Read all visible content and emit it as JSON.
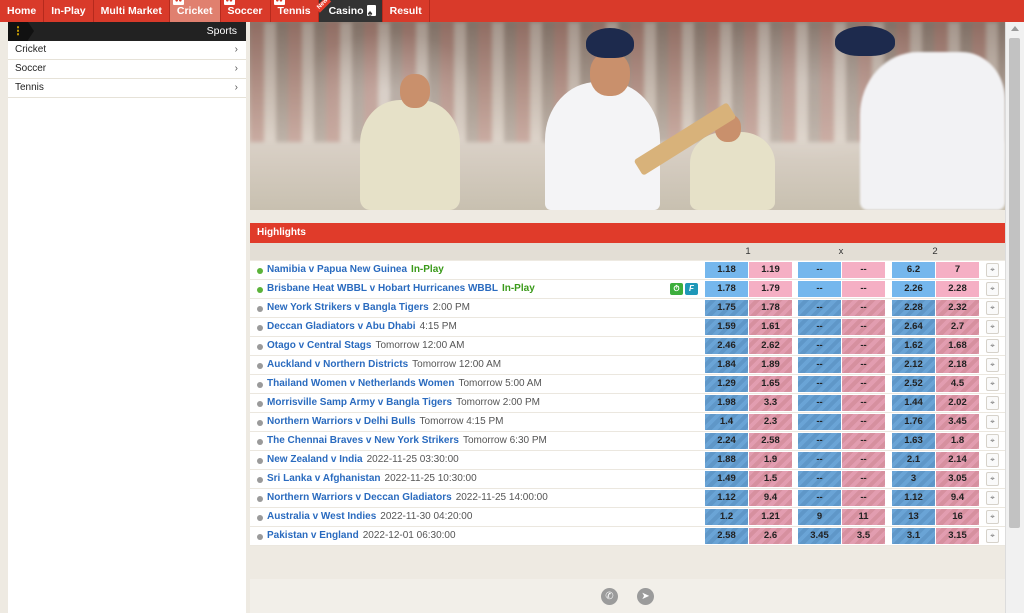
{
  "nav": {
    "items": [
      {
        "label": "Home",
        "active": false
      },
      {
        "label": "In-Play",
        "active": false
      },
      {
        "label": "Multi Market",
        "active": false
      },
      {
        "label": "Cricket",
        "active": true
      },
      {
        "label": "Soccer",
        "active": false
      },
      {
        "label": "Tennis",
        "active": false
      },
      {
        "label": "Casino",
        "active": false
      },
      {
        "label": "Result",
        "active": false
      }
    ],
    "new_ribbon": "New"
  },
  "sidebar": {
    "title": "Sports",
    "menu_icon": "⋮",
    "items": [
      {
        "label": "Cricket"
      },
      {
        "label": "Soccer"
      },
      {
        "label": "Tennis"
      }
    ]
  },
  "highlights": {
    "title": "Highlights",
    "col_1": "1",
    "col_x": "x",
    "col_2": "2"
  },
  "matches": [
    {
      "name": "Namibia v Papua New Guinea",
      "time": "",
      "live": true,
      "live_label": "In-Play",
      "icons": false,
      "suspended": false,
      "odds": [
        "1.18",
        "1.19",
        "--",
        "--",
        "6.2",
        "7"
      ]
    },
    {
      "name": "Brisbane Heat WBBL v Hobart Hurricanes WBBL",
      "time": "",
      "live": true,
      "live_label": "In-Play",
      "icons": true,
      "suspended": false,
      "odds": [
        "1.78",
        "1.79",
        "--",
        "--",
        "2.26",
        "2.28"
      ]
    },
    {
      "name": "New York Strikers v Bangla Tigers",
      "time": "2:00 PM",
      "live": false,
      "icons": false,
      "suspended": true,
      "odds": [
        "1.75",
        "1.78",
        "--",
        "--",
        "2.28",
        "2.32"
      ]
    },
    {
      "name": "Deccan Gladiators v Abu Dhabi",
      "time": "4:15 PM",
      "live": false,
      "icons": false,
      "suspended": true,
      "odds": [
        "1.59",
        "1.61",
        "--",
        "--",
        "2.64",
        "2.7"
      ]
    },
    {
      "name": "Otago v Central Stags",
      "time": "Tomorrow 12:00 AM",
      "live": false,
      "icons": false,
      "suspended": true,
      "odds": [
        "2.46",
        "2.62",
        "--",
        "--",
        "1.62",
        "1.68"
      ]
    },
    {
      "name": "Auckland v Northern Districts",
      "time": "Tomorrow 12:00 AM",
      "live": false,
      "icons": false,
      "suspended": true,
      "odds": [
        "1.84",
        "1.89",
        "--",
        "--",
        "2.12",
        "2.18"
      ]
    },
    {
      "name": "Thailand Women v Netherlands Women",
      "time": "Tomorrow 5:00 AM",
      "live": false,
      "icons": false,
      "suspended": true,
      "odds": [
        "1.29",
        "1.65",
        "--",
        "--",
        "2.52",
        "4.5"
      ]
    },
    {
      "name": "Morrisville Samp Army v Bangla Tigers",
      "time": "Tomorrow 2:00 PM",
      "live": false,
      "icons": false,
      "suspended": true,
      "odds": [
        "1.98",
        "3.3",
        "--",
        "--",
        "1.44",
        "2.02"
      ]
    },
    {
      "name": "Northern Warriors v Delhi Bulls",
      "time": "Tomorrow 4:15 PM",
      "live": false,
      "icons": false,
      "suspended": true,
      "odds": [
        "1.4",
        "2.3",
        "--",
        "--",
        "1.76",
        "3.45"
      ]
    },
    {
      "name": "The Chennai Braves v New York Strikers",
      "time": "Tomorrow 6:30 PM",
      "live": false,
      "icons": false,
      "suspended": true,
      "odds": [
        "2.24",
        "2.58",
        "--",
        "--",
        "1.63",
        "1.8"
      ]
    },
    {
      "name": "New Zealand v India",
      "time": "2022-11-25 03:30:00",
      "live": false,
      "icons": false,
      "suspended": true,
      "odds": [
        "1.88",
        "1.9",
        "--",
        "--",
        "2.1",
        "2.14"
      ]
    },
    {
      "name": "Sri Lanka v Afghanistan",
      "time": "2022-11-25 10:30:00",
      "live": false,
      "icons": false,
      "suspended": true,
      "odds": [
        "1.49",
        "1.5",
        "--",
        "--",
        "3",
        "3.05"
      ]
    },
    {
      "name": "Northern Warriors v Deccan Gladiators",
      "time": "2022-11-25 14:00:00",
      "live": false,
      "icons": false,
      "suspended": true,
      "odds": [
        "1.12",
        "9.4",
        "--",
        "--",
        "1.12",
        "9.4"
      ]
    },
    {
      "name": "Australia v West Indies",
      "time": "2022-11-30 04:20:00",
      "live": false,
      "icons": false,
      "suspended": true,
      "odds": [
        "1.2",
        "1.21",
        "9",
        "11",
        "13",
        "16"
      ]
    },
    {
      "name": "Pakistan v England",
      "time": "2022-12-01 06:30:00",
      "live": false,
      "icons": false,
      "suspended": true,
      "odds": [
        "2.58",
        "2.6",
        "3.45",
        "3.5",
        "3.1",
        "3.15"
      ]
    }
  ],
  "colors": {
    "nav_red": "#d93a2a",
    "back_blue": "#75b7ed",
    "lay_pink": "#f5afc4",
    "live_green": "#5bb33a",
    "link_blue": "#2a6bbf"
  }
}
